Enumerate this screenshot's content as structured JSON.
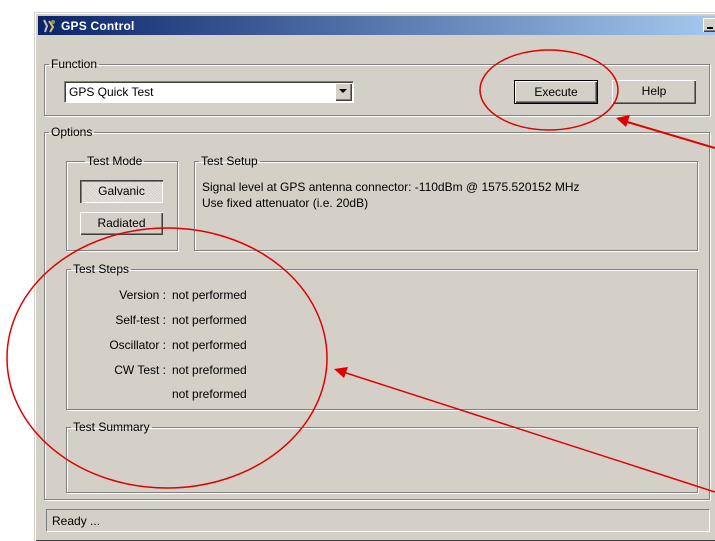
{
  "window": {
    "title": "GPS Control",
    "controls": [
      "minimize-icon",
      "maximize-icon",
      "close-icon"
    ]
  },
  "function_group": {
    "legend": "Function",
    "selected": "GPS Quick Test",
    "execute_label": "Execute",
    "help_label": "Help"
  },
  "options_group": {
    "legend": "Options",
    "test_mode": {
      "legend": "Test Mode",
      "galvanic_label": "Galvanic",
      "radiated_label": "Radiated",
      "selected": "Galvanic"
    },
    "test_setup": {
      "legend": "Test Setup",
      "line1": "Signal level at GPS antenna connector: -110dBm @ 1575.520152 MHz",
      "line2": "Use fixed attenuator (i.e. 20dB)"
    }
  },
  "test_steps": {
    "legend": "Test Steps",
    "rows": [
      {
        "label": "Version :",
        "value": "not performed"
      },
      {
        "label": "Self-test :",
        "value": "not performed"
      },
      {
        "label": "Oscillator :",
        "value": "not performed"
      },
      {
        "label": "CW Test :",
        "value": "not preformed"
      },
      {
        "label": "",
        "value": "not preformed"
      }
    ]
  },
  "test_summary": {
    "legend": "Test Summary"
  },
  "status": {
    "text": "Ready ..."
  },
  "annotation_color": "#e00000"
}
